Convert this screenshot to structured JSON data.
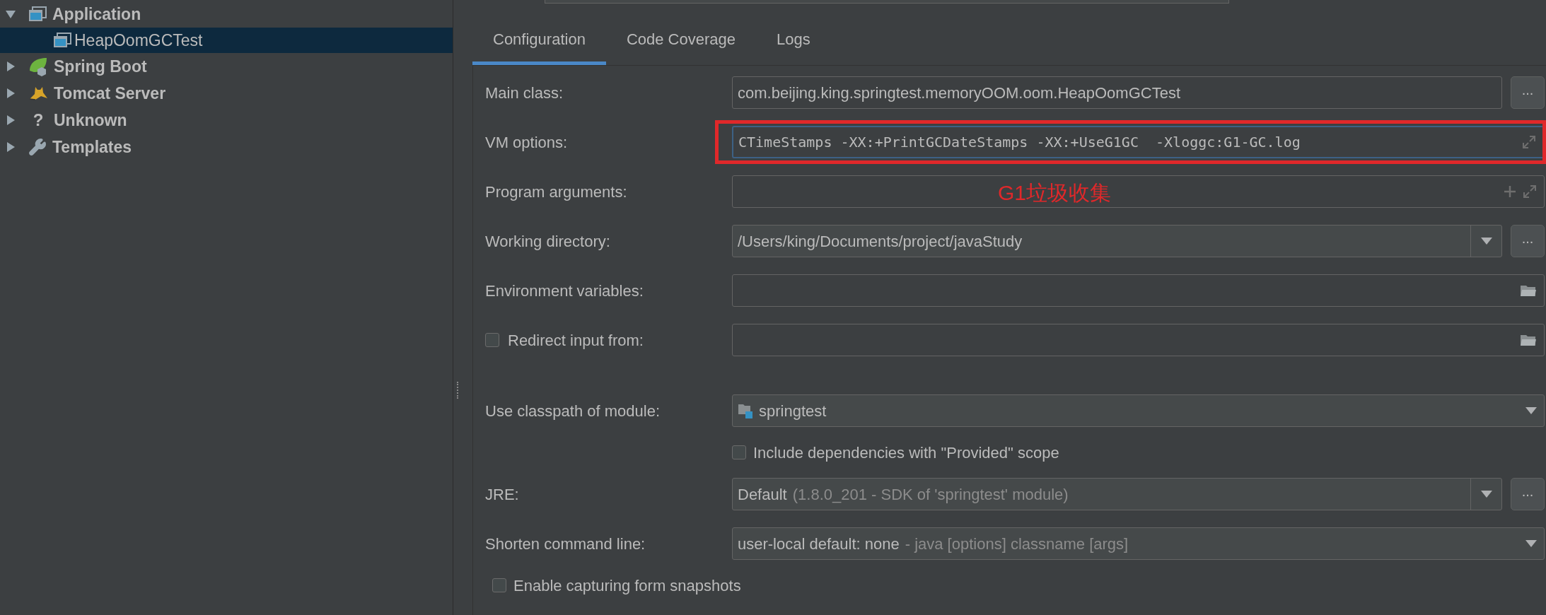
{
  "tree": [
    {
      "label": "Application",
      "kind": "app",
      "expanded": true,
      "selected": false,
      "children": [
        {
          "label": "HeapOomGCTest",
          "kind": "app",
          "selected": true
        }
      ]
    },
    {
      "label": "Spring Boot",
      "kind": "spring",
      "expanded": false,
      "selected": false
    },
    {
      "label": "Tomcat Server",
      "kind": "tomcat",
      "expanded": false,
      "selected": false
    },
    {
      "label": "Unknown",
      "kind": "glyph",
      "glyph": "?",
      "expanded": false,
      "selected": false
    },
    {
      "label": "Templates",
      "kind": "wrench",
      "expanded": false,
      "selected": false
    }
  ],
  "tabs": [
    {
      "label": "Configuration",
      "selected": true
    },
    {
      "label": "Code Coverage",
      "selected": false
    },
    {
      "label": "Logs",
      "selected": false
    }
  ],
  "sections": [
    [
      {
        "kind": "browse-field",
        "label": "Main class:",
        "value": "com.beijing.king.springtest.memoryOOM.oom.HeapOomGCTest",
        "more": "..."
      },
      {
        "kind": "expandable-field",
        "label": "VM options:",
        "value": "CTimeStamps -XX:+PrintGCDateStamps -XX:+UseG1GC  -Xloggc:G1-GC.log",
        "focused": true,
        "highlighted": true
      },
      {
        "kind": "arguments-field",
        "label": "Program arguments:",
        "note": "G1垃圾收集"
      },
      {
        "kind": "browse-combo",
        "label": "Working directory:",
        "value": "/Users/king/Documents/project/javaStudy",
        "more": "..."
      },
      {
        "kind": "folder-field",
        "label": "Environment variables:"
      },
      {
        "kind": "folder-field",
        "label": "Redirect input from:",
        "checked": false
      }
    ],
    [
      {
        "kind": "module-combo",
        "label": "Use classpath of module:",
        "value": "springtest"
      },
      {
        "kind": "indented-checkbox",
        "label": "Include dependencies with \"Provided\" scope",
        "checked": false
      },
      {
        "kind": "browse-combo",
        "label": "JRE:",
        "value": "Default",
        "hint": "(1.8.0_201 - SDK of 'springtest' module)",
        "more": "..."
      },
      {
        "kind": "combo",
        "label": "Shorten command line:",
        "value": "user-local default: none",
        "hint": "- java [options] classname [args]"
      },
      {
        "kind": "checkbox",
        "label": "Enable capturing form snapshots",
        "checked": false
      }
    ]
  ]
}
